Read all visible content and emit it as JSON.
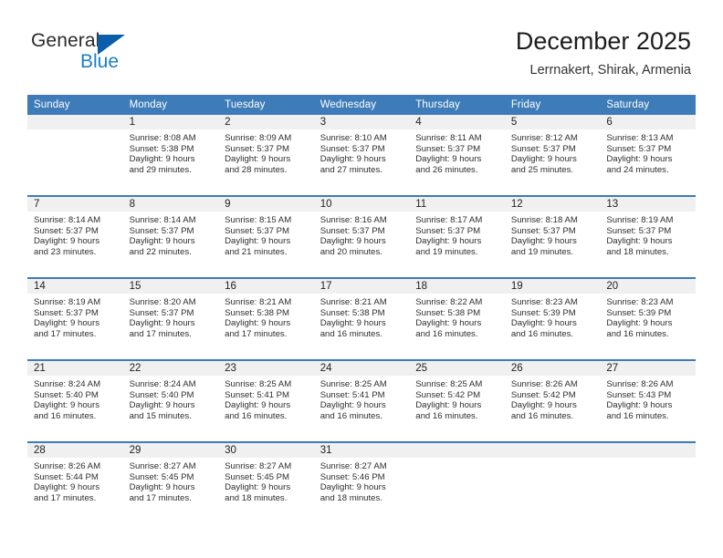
{
  "brand": {
    "name_part1": "General",
    "name_part2": "Blue",
    "accent_color": "#1b7fc4",
    "triangle_color": "#0b5faa",
    "triangle_icon": "triangle-logo-icon"
  },
  "header": {
    "title": "December 2025",
    "location": "Lerrnakert, Shirak, Armenia"
  },
  "calendar": {
    "header_bg": "#3d7cb8",
    "daynum_bg": "#f0f0f0",
    "weekday_headers": [
      "Sunday",
      "Monday",
      "Tuesday",
      "Wednesday",
      "Thursday",
      "Friday",
      "Saturday"
    ],
    "weeks": [
      [
        {
          "day": "",
          "lines": []
        },
        {
          "day": "1",
          "lines": [
            "Sunrise: 8:08 AM",
            "Sunset: 5:38 PM",
            "Daylight: 9 hours",
            "and 29 minutes."
          ]
        },
        {
          "day": "2",
          "lines": [
            "Sunrise: 8:09 AM",
            "Sunset: 5:37 PM",
            "Daylight: 9 hours",
            "and 28 minutes."
          ]
        },
        {
          "day": "3",
          "lines": [
            "Sunrise: 8:10 AM",
            "Sunset: 5:37 PM",
            "Daylight: 9 hours",
            "and 27 minutes."
          ]
        },
        {
          "day": "4",
          "lines": [
            "Sunrise: 8:11 AM",
            "Sunset: 5:37 PM",
            "Daylight: 9 hours",
            "and 26 minutes."
          ]
        },
        {
          "day": "5",
          "lines": [
            "Sunrise: 8:12 AM",
            "Sunset: 5:37 PM",
            "Daylight: 9 hours",
            "and 25 minutes."
          ]
        },
        {
          "day": "6",
          "lines": [
            "Sunrise: 8:13 AM",
            "Sunset: 5:37 PM",
            "Daylight: 9 hours",
            "and 24 minutes."
          ]
        }
      ],
      [
        {
          "day": "7",
          "lines": [
            "Sunrise: 8:14 AM",
            "Sunset: 5:37 PM",
            "Daylight: 9 hours",
            "and 23 minutes."
          ]
        },
        {
          "day": "8",
          "lines": [
            "Sunrise: 8:14 AM",
            "Sunset: 5:37 PM",
            "Daylight: 9 hours",
            "and 22 minutes."
          ]
        },
        {
          "day": "9",
          "lines": [
            "Sunrise: 8:15 AM",
            "Sunset: 5:37 PM",
            "Daylight: 9 hours",
            "and 21 minutes."
          ]
        },
        {
          "day": "10",
          "lines": [
            "Sunrise: 8:16 AM",
            "Sunset: 5:37 PM",
            "Daylight: 9 hours",
            "and 20 minutes."
          ]
        },
        {
          "day": "11",
          "lines": [
            "Sunrise: 8:17 AM",
            "Sunset: 5:37 PM",
            "Daylight: 9 hours",
            "and 19 minutes."
          ]
        },
        {
          "day": "12",
          "lines": [
            "Sunrise: 8:18 AM",
            "Sunset: 5:37 PM",
            "Daylight: 9 hours",
            "and 19 minutes."
          ]
        },
        {
          "day": "13",
          "lines": [
            "Sunrise: 8:19 AM",
            "Sunset: 5:37 PM",
            "Daylight: 9 hours",
            "and 18 minutes."
          ]
        }
      ],
      [
        {
          "day": "14",
          "lines": [
            "Sunrise: 8:19 AM",
            "Sunset: 5:37 PM",
            "Daylight: 9 hours",
            "and 17 minutes."
          ]
        },
        {
          "day": "15",
          "lines": [
            "Sunrise: 8:20 AM",
            "Sunset: 5:37 PM",
            "Daylight: 9 hours",
            "and 17 minutes."
          ]
        },
        {
          "day": "16",
          "lines": [
            "Sunrise: 8:21 AM",
            "Sunset: 5:38 PM",
            "Daylight: 9 hours",
            "and 17 minutes."
          ]
        },
        {
          "day": "17",
          "lines": [
            "Sunrise: 8:21 AM",
            "Sunset: 5:38 PM",
            "Daylight: 9 hours",
            "and 16 minutes."
          ]
        },
        {
          "day": "18",
          "lines": [
            "Sunrise: 8:22 AM",
            "Sunset: 5:38 PM",
            "Daylight: 9 hours",
            "and 16 minutes."
          ]
        },
        {
          "day": "19",
          "lines": [
            "Sunrise: 8:23 AM",
            "Sunset: 5:39 PM",
            "Daylight: 9 hours",
            "and 16 minutes."
          ]
        },
        {
          "day": "20",
          "lines": [
            "Sunrise: 8:23 AM",
            "Sunset: 5:39 PM",
            "Daylight: 9 hours",
            "and 16 minutes."
          ]
        }
      ],
      [
        {
          "day": "21",
          "lines": [
            "Sunrise: 8:24 AM",
            "Sunset: 5:40 PM",
            "Daylight: 9 hours",
            "and 16 minutes."
          ]
        },
        {
          "day": "22",
          "lines": [
            "Sunrise: 8:24 AM",
            "Sunset: 5:40 PM",
            "Daylight: 9 hours",
            "and 15 minutes."
          ]
        },
        {
          "day": "23",
          "lines": [
            "Sunrise: 8:25 AM",
            "Sunset: 5:41 PM",
            "Daylight: 9 hours",
            "and 16 minutes."
          ]
        },
        {
          "day": "24",
          "lines": [
            "Sunrise: 8:25 AM",
            "Sunset: 5:41 PM",
            "Daylight: 9 hours",
            "and 16 minutes."
          ]
        },
        {
          "day": "25",
          "lines": [
            "Sunrise: 8:25 AM",
            "Sunset: 5:42 PM",
            "Daylight: 9 hours",
            "and 16 minutes."
          ]
        },
        {
          "day": "26",
          "lines": [
            "Sunrise: 8:26 AM",
            "Sunset: 5:42 PM",
            "Daylight: 9 hours",
            "and 16 minutes."
          ]
        },
        {
          "day": "27",
          "lines": [
            "Sunrise: 8:26 AM",
            "Sunset: 5:43 PM",
            "Daylight: 9 hours",
            "and 16 minutes."
          ]
        }
      ],
      [
        {
          "day": "28",
          "lines": [
            "Sunrise: 8:26 AM",
            "Sunset: 5:44 PM",
            "Daylight: 9 hours",
            "and 17 minutes."
          ]
        },
        {
          "day": "29",
          "lines": [
            "Sunrise: 8:27 AM",
            "Sunset: 5:45 PM",
            "Daylight: 9 hours",
            "and 17 minutes."
          ]
        },
        {
          "day": "30",
          "lines": [
            "Sunrise: 8:27 AM",
            "Sunset: 5:45 PM",
            "Daylight: 9 hours",
            "and 18 minutes."
          ]
        },
        {
          "day": "31",
          "lines": [
            "Sunrise: 8:27 AM",
            "Sunset: 5:46 PM",
            "Daylight: 9 hours",
            "and 18 minutes."
          ]
        },
        {
          "day": "",
          "lines": []
        },
        {
          "day": "",
          "lines": []
        },
        {
          "day": "",
          "lines": []
        }
      ]
    ]
  }
}
